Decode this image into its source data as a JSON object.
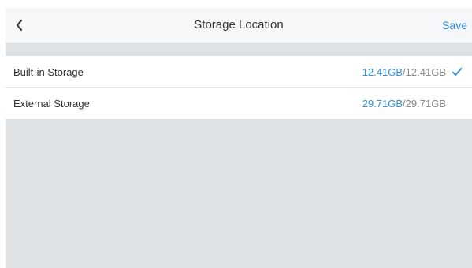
{
  "header": {
    "back_icon": "chevron-left-icon",
    "title": "Storage Location",
    "save_label": "Save"
  },
  "storage_options": [
    {
      "label": "Built-in Storage",
      "available": "12.41GB",
      "separator": " / ",
      "total": "12.41GB",
      "selected": true
    },
    {
      "label": "External Storage",
      "available": "29.71GB",
      "separator": " / ",
      "total": "29.71GB",
      "selected": false
    }
  ],
  "colors": {
    "accent": "#2f8fdf",
    "header_bg": "#f6f7f8",
    "page_bg": "#dee2e4",
    "text": "#333333",
    "secondary_text": "#888888"
  }
}
